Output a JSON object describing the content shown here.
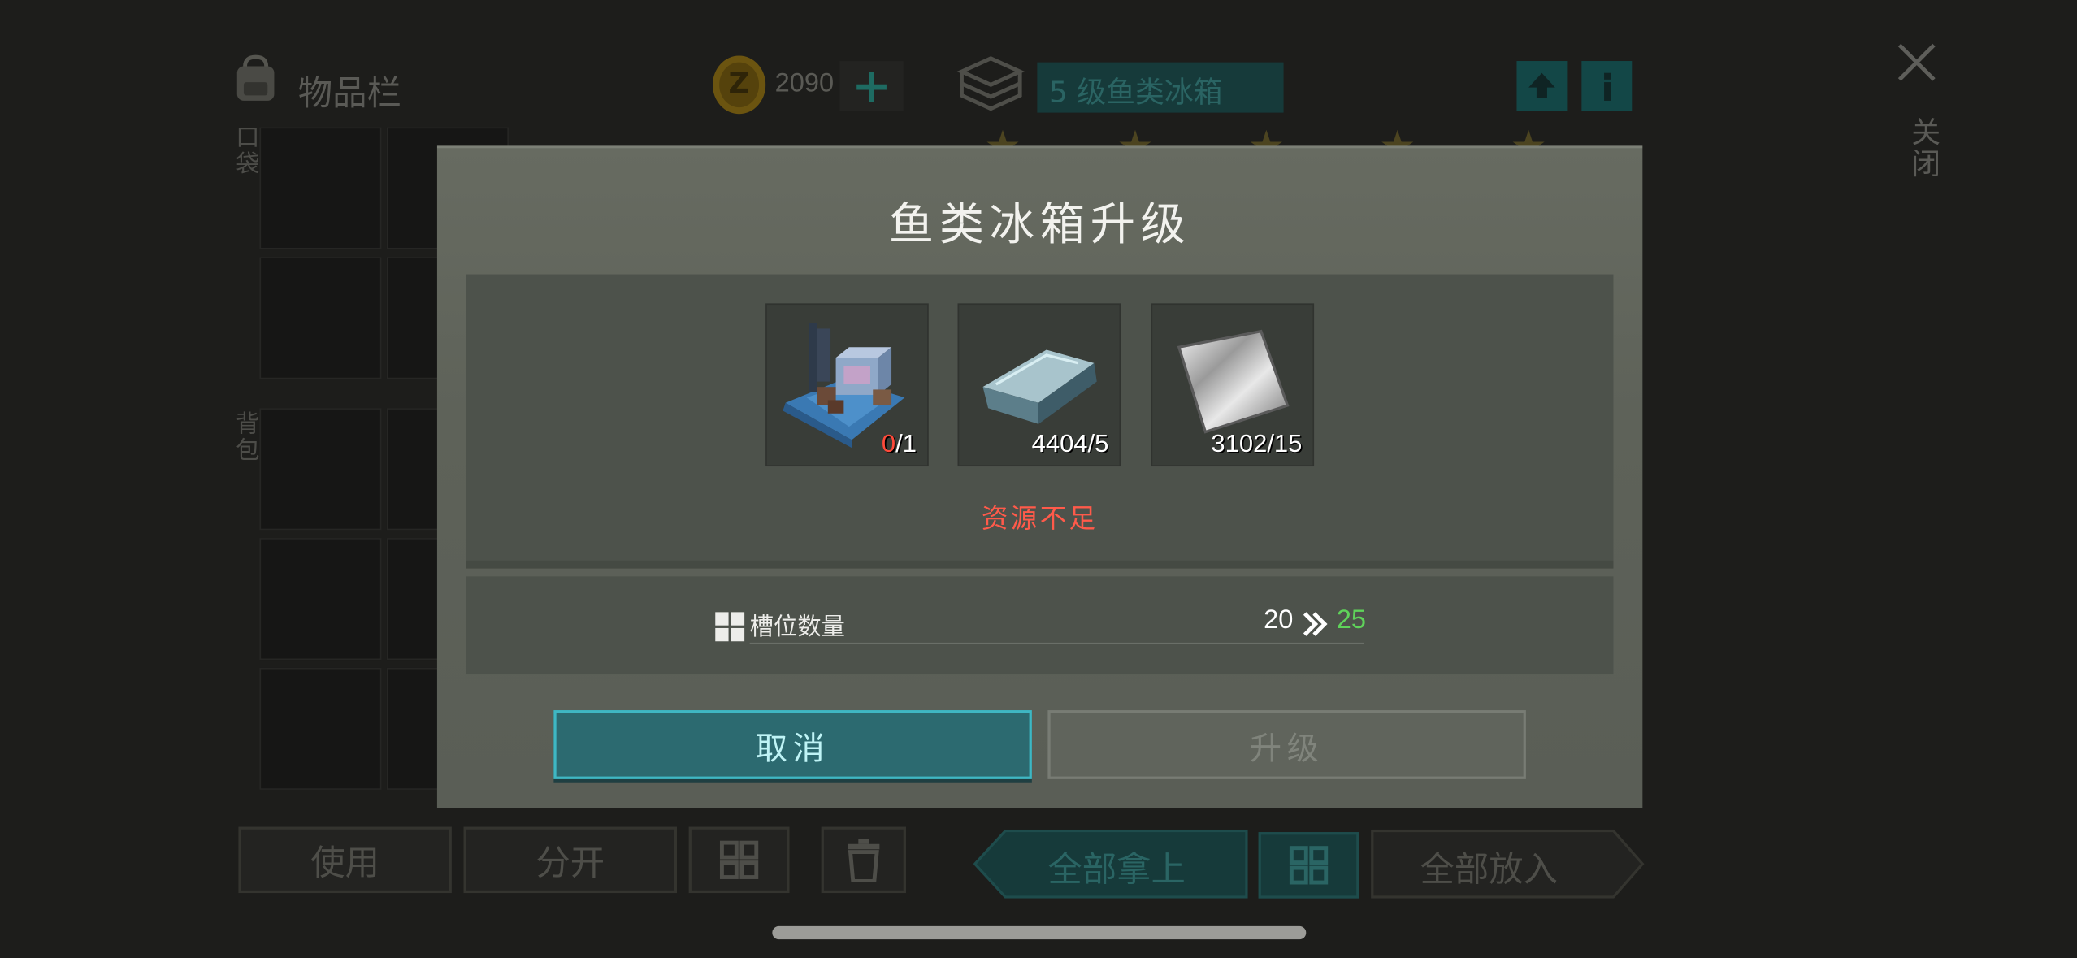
{
  "inventory": {
    "title": "物品栏",
    "coins": "2090",
    "coin_symbol": "Z",
    "plus_label": "+",
    "container_name": "5 级鱼类冰箱",
    "pocket_label": "口袋",
    "backpack_label": "背包",
    "close_label": "关闭",
    "buttons": {
      "use": "使用",
      "split": "分开",
      "take_all": "全部拿上",
      "put_all": "全部放入"
    }
  },
  "dialog": {
    "title": "鱼类冰箱升级",
    "requirements": [
      {
        "icon": "blueprint-icon",
        "have": "0",
        "need": "/1",
        "insufficient": true
      },
      {
        "icon": "iron-ingot-icon",
        "have": "4404",
        "need": "/5",
        "insufficient": false
      },
      {
        "icon": "steel-plate-icon",
        "have": "3102",
        "need": "/15",
        "insufficient": false
      }
    ],
    "warning": "资源不足",
    "stat": {
      "label": "槽位数量",
      "from": "20",
      "to": "25"
    },
    "cancel_label": "取消",
    "upgrade_label": "升级"
  },
  "colors": {
    "accent": "#3fb7c3",
    "warning": "#ff5a4a",
    "increase": "#5fd35a",
    "lack": "#ff4a3a"
  }
}
